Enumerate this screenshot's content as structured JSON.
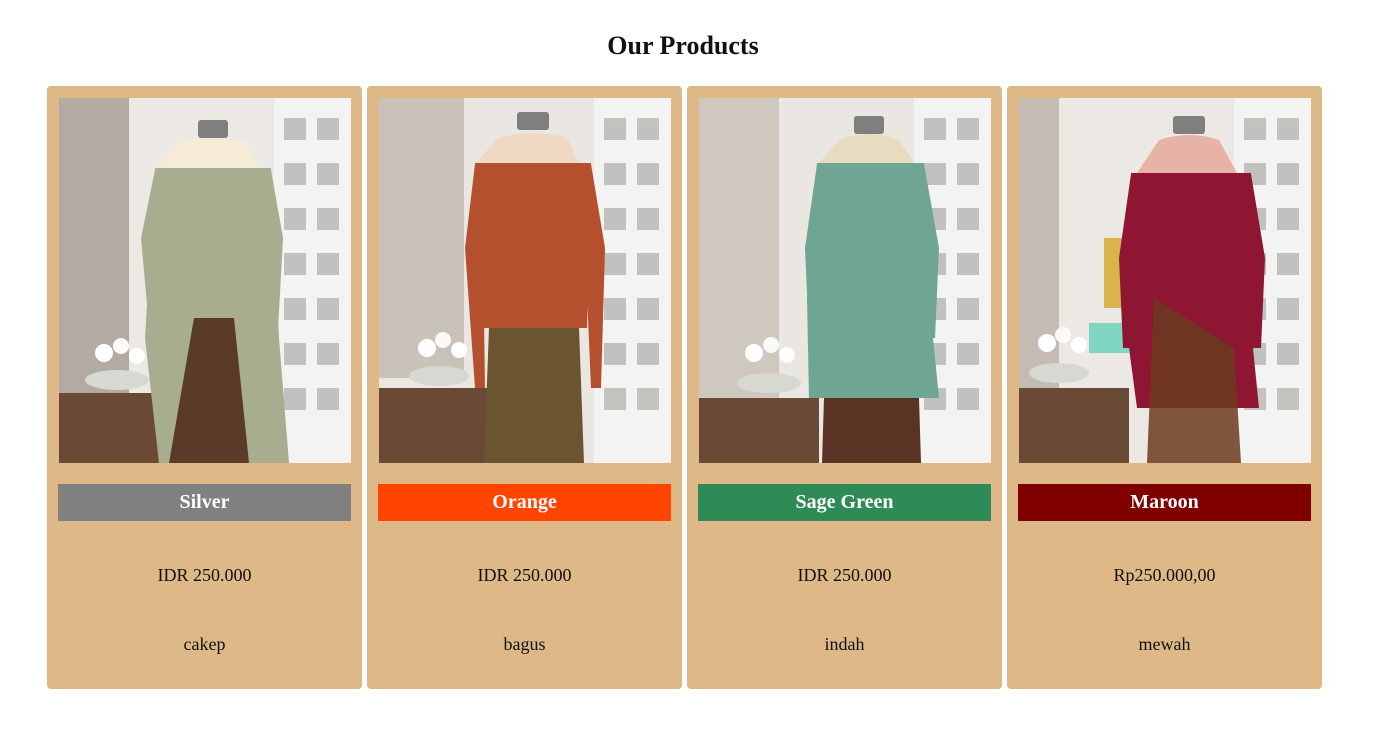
{
  "page": {
    "title": "Our Products"
  },
  "products": [
    {
      "color_name": "Silver",
      "color_hex": "#808080",
      "price": "IDR 250.000",
      "description": "cakep",
      "dress_hex": "#a9ad90",
      "skirt_hex": "#5a3b2a"
    },
    {
      "color_name": "Orange",
      "color_hex": "#ff4500",
      "price": "IDR 250.000",
      "description": "bagus",
      "dress_hex": "#b5502e",
      "skirt_hex": "#6a5530"
    },
    {
      "color_name": "Sage Green",
      "color_hex": "#2e8b57",
      "price": "IDR 250.000",
      "description": "indah",
      "dress_hex": "#6fa593",
      "skirt_hex": "#5a3324"
    },
    {
      "color_name": "Maroon",
      "color_hex": "#800000",
      "price": "Rp250.000,00",
      "description": "mewah",
      "dress_hex": "#8e1633",
      "skirt_hex": "#6b3a20"
    }
  ]
}
